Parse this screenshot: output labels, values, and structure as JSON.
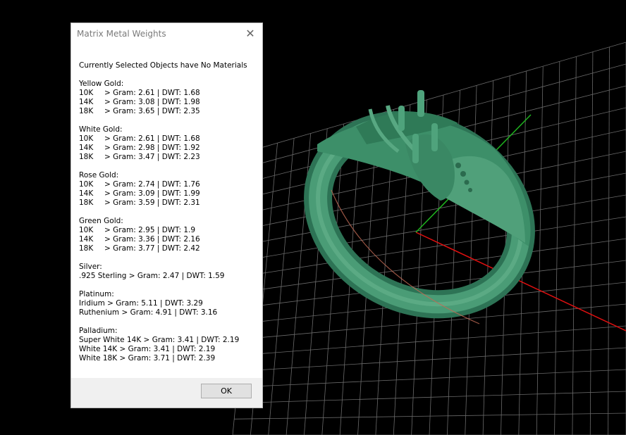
{
  "dialog": {
    "title": "Matrix Metal Weights",
    "close_icon": "✕",
    "header": "Currently Selected Objects have No Materials",
    "groups": [
      {
        "name": "Yellow Gold:",
        "rows": [
          {
            "karat": "10K",
            "value": "> Gram: 2.61 | DWT: 1.68"
          },
          {
            "karat": "14K",
            "value": "> Gram: 3.08 | DWT: 1.98"
          },
          {
            "karat": "18K",
            "value": "> Gram: 3.65 | DWT: 2.35"
          }
        ]
      },
      {
        "name": "White Gold:",
        "rows": [
          {
            "karat": "10K",
            "value": "> Gram: 2.61 | DWT: 1.68"
          },
          {
            "karat": "14K",
            "value": "> Gram: 2.98 | DWT: 1.92"
          },
          {
            "karat": "18K",
            "value": "> Gram: 3.47 | DWT: 2.23"
          }
        ]
      },
      {
        "name": "Rose Gold:",
        "rows": [
          {
            "karat": "10K",
            "value": "> Gram: 2.74 | DWT: 1.76"
          },
          {
            "karat": "14K",
            "value": "> Gram: 3.09 | DWT: 1.99"
          },
          {
            "karat": "18K",
            "value": "> Gram: 3.59 | DWT: 2.31"
          }
        ]
      },
      {
        "name": "Green Gold:",
        "rows": [
          {
            "karat": "10K",
            "value": "> Gram: 2.95 | DWT: 1.9"
          },
          {
            "karat": "14K",
            "value": "> Gram: 3.36 | DWT: 2.16"
          },
          {
            "karat": "18K",
            "value": "> Gram: 3.77 | DWT: 2.42"
          }
        ]
      },
      {
        "name": "Silver:",
        "rows": [
          {
            "karat": "",
            "value": ".925 Sterling > Gram: 2.47 | DWT: 1.59"
          }
        ]
      },
      {
        "name": "Platinum:",
        "rows": [
          {
            "karat": "",
            "value": "Iridium > Gram: 5.11 | DWT: 3.29"
          },
          {
            "karat": "",
            "value": "Ruthenium > Gram: 4.91 | DWT: 3.16"
          }
        ]
      },
      {
        "name": "Palladium:",
        "rows": [
          {
            "karat": "",
            "value": "Super White 14K > Gram: 3.41 | DWT: 2.19"
          },
          {
            "karat": "",
            "value": "White 14K > Gram: 3.41 | DWT: 2.19"
          },
          {
            "karat": "",
            "value": "White 18K > Gram: 3.71 | DWT: 2.39"
          }
        ]
      }
    ],
    "ok_label": "OK"
  },
  "viewport": {
    "background": "#000000",
    "grid_color": "#6a6a6a",
    "x_axis_color": "#e01010",
    "y_axis_color": "#1fb41f",
    "model_color": "#3a8a66"
  }
}
